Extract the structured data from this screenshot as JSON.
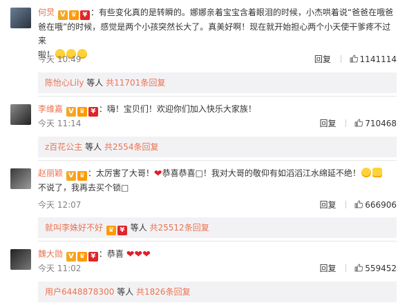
{
  "comments": [
    {
      "name": "何炅",
      "text_lines": [
        "：有些变化真的是转瞬的。娜娜亲着宝宝含着眼泪的时候，小杰哄着说“爸爸在哦爸",
        "爸在哦”的时候，感觉是两个小孩突然长大了。真美好啊！现在就开始担心两个小天使干爹疼不过来",
        "啦！"
      ],
      "time": "今天 10:49",
      "reply_label": "回复",
      "likes": "1141114",
      "sub_name": "陈怡心Lily",
      "sub_mid": "等人",
      "sub_count": "共11701条回复"
    },
    {
      "name": "李维嘉",
      "text_lines": [
        "：嗨！宝贝们！欢迎你们加入快乐大家族！"
      ],
      "time": "今天 11:14",
      "reply_label": "回复",
      "likes": "710468",
      "sub_name": "z百花公主",
      "sub_mid": "等人",
      "sub_count": "共2554条回复"
    },
    {
      "name": "赵丽颖",
      "text_lines": [
        "：太厉害了大哥！",
        "恭喜恭喜□！我对大哥的敬仰有如滔滔江水绵延不绝！",
        "不说了，我再去买个锁□"
      ],
      "time": "今天 12:07",
      "reply_label": "回复",
      "likes": "666906",
      "sub_name": "就叫李姝好不好",
      "sub_mid": "等人",
      "sub_count": "共25512条回复"
    },
    {
      "name": "魏大勋",
      "text_lines": [
        "：恭喜"
      ],
      "time": "今天 11:02",
      "reply_label": "回复",
      "likes": "559452",
      "sub_name": "用户6448878300",
      "sub_mid": "等人",
      "sub_count": "共1826条回复"
    }
  ],
  "icons": {
    "verified": "verified-v-icon",
    "vip": "vip-crown-icon",
    "redpacket": "red-packet-icon",
    "like": "thumbs-up-icon"
  },
  "colors": {
    "name": "#eb7350",
    "accent_badge": "#f5a623",
    "heart": "#e01d2b",
    "subbg": "#f2f2f5"
  }
}
